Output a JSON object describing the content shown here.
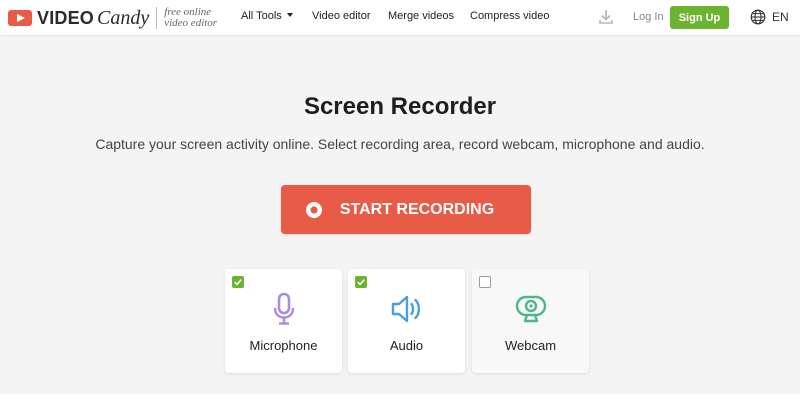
{
  "header": {
    "brand": {
      "video": "VIDEO",
      "candy": "Candy",
      "tagline_line1": "free online",
      "tagline_line2": "video editor"
    },
    "nav": [
      {
        "label": "All Tools",
        "has_dropdown": true
      },
      {
        "label": "Video editor"
      },
      {
        "label": "Merge videos"
      },
      {
        "label": "Compress video"
      }
    ],
    "download_icon": "download-icon",
    "login_label": "Log In",
    "signup_label": "Sign Up",
    "language": "EN"
  },
  "main": {
    "title": "Screen Recorder",
    "subtitle": "Capture your screen activity online. Select recording area, record webcam, microphone and audio.",
    "record_button_label": "START RECORDING",
    "options": [
      {
        "label": "Microphone",
        "checked": true,
        "icon": "microphone-icon",
        "color": "#a98be0"
      },
      {
        "label": "Audio",
        "checked": true,
        "icon": "speaker-icon",
        "color": "#4aa0d8"
      },
      {
        "label": "Webcam",
        "checked": false,
        "icon": "webcam-icon",
        "color": "#4cb68a"
      }
    ]
  },
  "colors": {
    "accent_red": "#e85b46",
    "signup_green": "#6cb42f",
    "background": "#f4f4f4"
  }
}
